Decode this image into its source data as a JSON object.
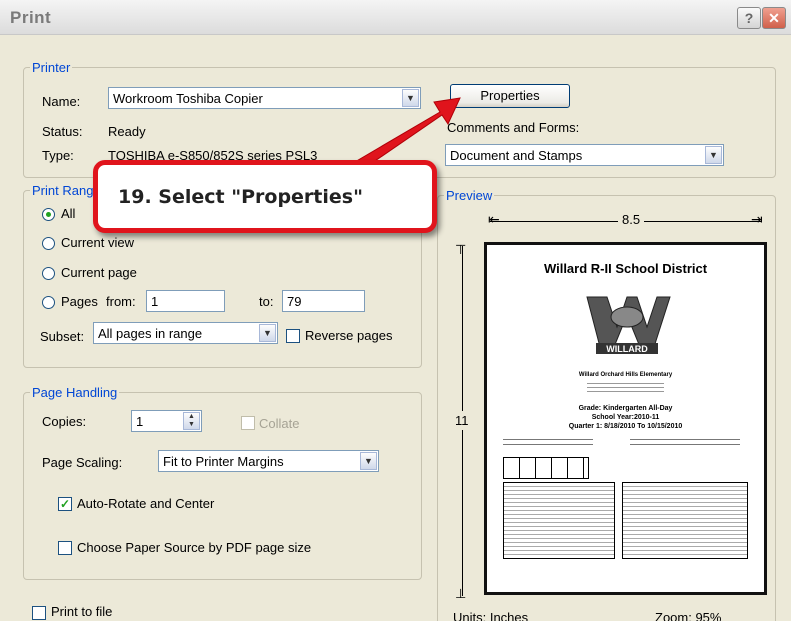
{
  "dialog": {
    "title": "Print",
    "help_icon": "question-mark-icon",
    "close_icon": "close-x-icon"
  },
  "printer": {
    "group_label": "Printer",
    "name_label": "Name:",
    "name_value": "Workroom Toshiba Copier",
    "status_label": "Status:",
    "status_value": "Ready",
    "type_label": "Type:",
    "type_value": "TOSHIBA e-S850/852S series PSL3",
    "properties_button": "Properties",
    "comments_label": "Comments and Forms:",
    "comments_value": "Document and Stamps"
  },
  "print_range": {
    "group_label": "Print Range",
    "all": "All",
    "current_view": "Current view",
    "current_page": "Current page",
    "pages_label": "Pages",
    "from_label": "from:",
    "from_value": "1",
    "to_label": "to:",
    "to_value": "79",
    "subset_label": "Subset:",
    "subset_value": "All pages in range",
    "reverse_pages": "Reverse pages"
  },
  "page_handling": {
    "group_label": "Page Handling",
    "copies_label": "Copies:",
    "copies_value": "1",
    "collate": "Collate",
    "scaling_label": "Page Scaling:",
    "scaling_value": "Fit to Printer Margins",
    "auto_rotate": "Auto-Rotate and Center",
    "choose_source": "Choose Paper Source by PDF page size"
  },
  "print_to_file": "Print to file",
  "preview": {
    "group_label": "Preview",
    "width": "8.5",
    "height": "11",
    "units": "Units: Inches",
    "zoom": "Zoom: 95%",
    "doc_title": "Willard R-II School District",
    "logo_text": "WILLARD",
    "school": "Willard Orchard Hills Elementary",
    "grade": "Grade: Kindergarten All-Day",
    "year": "School Year:2010-11",
    "quarter": "Quarter 1: 8/18/2010 To 10/15/2010"
  },
  "annotation": {
    "text": "19. Select \"Properties\""
  },
  "colors": {
    "accent": "#e0141c",
    "group_label": "#0046d5",
    "dialog_bg": "#ece9d8"
  }
}
